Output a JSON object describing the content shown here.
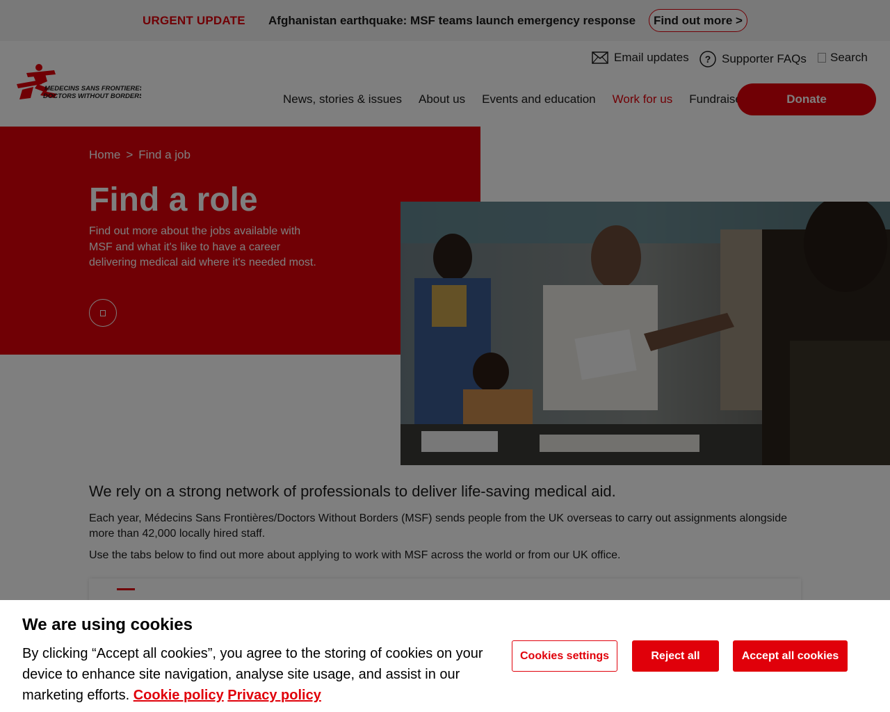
{
  "alert": {
    "label": "URGENT UPDATE",
    "text": "Afghanistan earthquake: MSF teams launch emergency response",
    "button": "Find out more >"
  },
  "header": {
    "logo_line1": "MEDECINS SANS FRONTIERES",
    "logo_line2": "DOCTORS WITHOUT BORDERS",
    "utility": {
      "email": "Email updates",
      "faqs": "Supporter FAQs",
      "search": "Search"
    },
    "nav": [
      {
        "label": "News, stories & issues"
      },
      {
        "label": "About us"
      },
      {
        "label": "Events and education"
      },
      {
        "label": "Work for us"
      },
      {
        "label": "Fundraise"
      }
    ],
    "donate": "Donate"
  },
  "hero": {
    "breadcrumb": [
      "Home",
      ">",
      "Find a job"
    ],
    "title": "Find a role",
    "description": "Find out more about the jobs available with MSF and what it's like to have a career delivering medical aid where it's needed most."
  },
  "content": {
    "lead": "We rely on a strong network of professionals to deliver life-saving medical aid.",
    "para1": "Each year, Médecins Sans Frontières/Doctors Without Borders (MSF) sends people from the UK overseas to carry out assignments alongside more than 42,000 locally hired staff.",
    "para2": "Use the tabs below to find out more about applying to work with MSF across the world or from our UK office."
  },
  "cookie": {
    "title": "We are using cookies",
    "text": "By clicking “Accept all cookies”, you agree to the storing of cookies on your device to enhance site navigation, analyse site usage, and assist in our marketing efforts.",
    "cookie_policy": "Cookie policy",
    "privacy_policy": "Privacy policy",
    "settings_button": "Cookies settings",
    "reject_button": "Reject all",
    "accept_button": "Accept all cookies"
  },
  "colors": {
    "brand_red": "#e0000a",
    "overlay": "rgba(0,0,0,0.5)"
  }
}
